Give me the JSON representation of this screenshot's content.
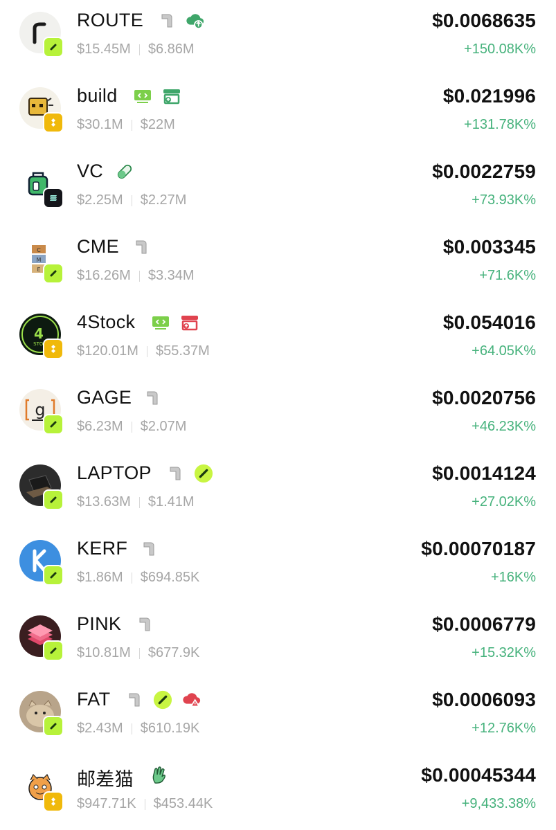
{
  "tokens": [
    {
      "name": "ROUTE",
      "mcap": "$15.45M",
      "liq": "$6.86M",
      "price": "$0.0068635",
      "change": "+150.08K%",
      "chain": "pump-icon"
    },
    {
      "name": "build",
      "mcap": "$30.1M",
      "liq": "$22M",
      "price": "$0.021996",
      "change": "+131.78K%",
      "chain": "bnb-icon"
    },
    {
      "name": "VC",
      "mcap": "$2.25M",
      "liq": "$2.27M",
      "price": "$0.0022759",
      "change": "+73.93K%",
      "chain": "solana-icon"
    },
    {
      "name": "CME",
      "mcap": "$16.26M",
      "liq": "$3.34M",
      "price": "$0.003345",
      "change": "+71.6K%",
      "chain": "pump-icon"
    },
    {
      "name": "4Stock",
      "mcap": "$120.01M",
      "liq": "$55.37M",
      "price": "$0.054016",
      "change": "+64.05K%",
      "chain": "bnb-icon"
    },
    {
      "name": "GAGE",
      "mcap": "$6.23M",
      "liq": "$2.07M",
      "price": "$0.0020756",
      "change": "+46.23K%",
      "chain": "pump-icon"
    },
    {
      "name": "LAPTOP",
      "mcap": "$13.63M",
      "liq": "$1.41M",
      "price": "$0.0014124",
      "change": "+27.02K%",
      "chain": "pump-icon"
    },
    {
      "name": "KERF",
      "mcap": "$1.86M",
      "liq": "$694.85K",
      "price": "$0.00070187",
      "change": "+16K%",
      "chain": "pump-icon"
    },
    {
      "name": "PINK",
      "mcap": "$10.81M",
      "liq": "$677.9K",
      "price": "$0.0006779",
      "change": "+15.32K%",
      "chain": "pump-icon"
    },
    {
      "name": "FAT",
      "mcap": "$2.43M",
      "liq": "$610.19K",
      "price": "$0.0006093",
      "change": "+12.76K%",
      "chain": "pump-icon"
    },
    {
      "name": "邮差猫",
      "mcap": "$947.71K",
      "liq": "$453.44K",
      "price": "$0.00045344",
      "change": "+9,433.38%",
      "chain": "bnb-icon"
    }
  ],
  "colors": {
    "positive": "#46b27c",
    "text": "#111111",
    "muted": "#a6a6a6",
    "pump_lime": "#b7f23a",
    "bnb_yellow": "#f0b90b",
    "badge_green": "#3fa66a",
    "badge_red": "#e0434f"
  }
}
